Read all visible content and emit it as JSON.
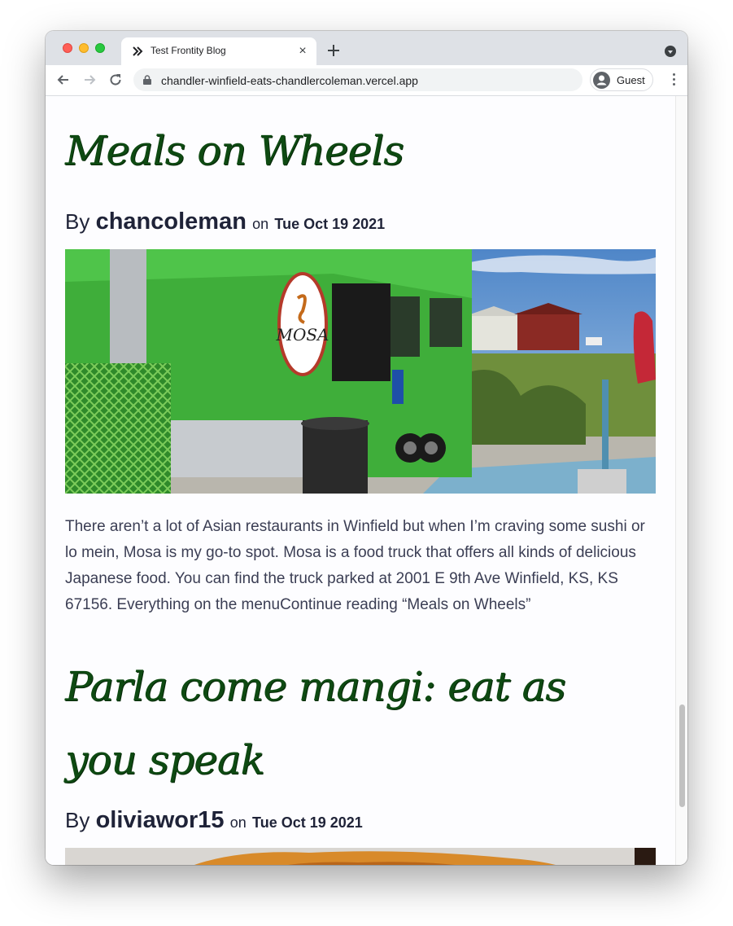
{
  "browser": {
    "tab_title": "Test Frontity Blog",
    "tab_close": "×",
    "url": "chandler-winfield-eats-chandlercoleman.vercel.app",
    "profile_label": "Guest"
  },
  "posts": [
    {
      "title": "Meals on Wheels",
      "by": "By",
      "author": "chancoleman",
      "on": "on",
      "date": "Tue Oct 19 2021",
      "excerpt": "There aren’t a lot of Asian restaurants in Winfield but when I’m craving some sushi or lo mein, Mosa is my go-to spot. Mosa is a food truck that offers all kinds of delicious Japanese food. You can find the truck parked at 2001 E 9th Ave Winfield, KS, KS 67156. Everything on the menuContinue reading “Meals on Wheels”",
      "image_text": "MOSA"
    },
    {
      "title_line1": "Parla come mangi: eat as",
      "title_line2": "you speak",
      "by": "By",
      "author": "oliviawor15",
      "on": "on",
      "date": "Tue Oct 19 2021"
    }
  ],
  "colors": {
    "title_green": "#0e4a12",
    "text": "#1f2338",
    "truck_green": "#3fae3a"
  }
}
